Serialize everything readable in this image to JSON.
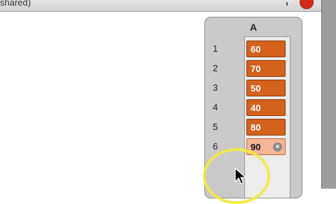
{
  "window": {
    "title": "shared)"
  },
  "list": {
    "header": "A",
    "items": [
      {
        "index": "1",
        "value": "60"
      },
      {
        "index": "2",
        "value": "70"
      },
      {
        "index": "3",
        "value": "50"
      },
      {
        "index": "4",
        "value": "40"
      },
      {
        "index": "5",
        "value": "80"
      },
      {
        "index": "6",
        "value": "90",
        "editing": true
      }
    ]
  },
  "icons": {
    "clear": "clear-icon",
    "cursor": "mouse-pointer-icon"
  },
  "colors": {
    "cell_fill": "#d4611c",
    "cell_editing_fill": "#f4b697",
    "panel_bg": "#cacaca",
    "highlight": "#f3ea3a"
  }
}
